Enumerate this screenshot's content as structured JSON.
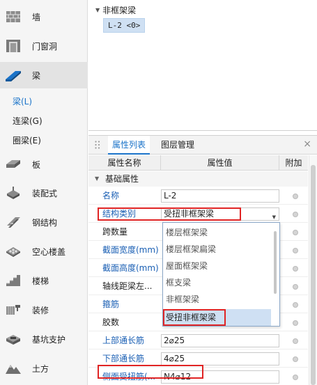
{
  "sidebar": {
    "items": [
      {
        "label": "墙",
        "icon": "wall-icon"
      },
      {
        "label": "门窗洞",
        "icon": "door-window-icon"
      },
      {
        "label": "梁",
        "icon": "beam-icon"
      },
      {
        "label": "板",
        "icon": "slab-icon"
      },
      {
        "label": "装配式",
        "icon": "prefab-icon"
      },
      {
        "label": "钢结构",
        "icon": "steel-structure-icon"
      },
      {
        "label": "空心楼盖",
        "icon": "hollow-floor-icon"
      },
      {
        "label": "楼梯",
        "icon": "stair-icon"
      },
      {
        "label": "装修",
        "icon": "decoration-icon"
      },
      {
        "label": "基坑支护",
        "icon": "foundation-pit-icon"
      },
      {
        "label": "土方",
        "icon": "earthwork-icon"
      }
    ],
    "sub_items": [
      {
        "label": "梁(L)"
      },
      {
        "label": "连梁(G)"
      },
      {
        "label": "圈梁(E)"
      }
    ]
  },
  "tree": {
    "group_label": "非框架梁",
    "leaf_label": "L-2 <0>"
  },
  "panel": {
    "tabs": [
      {
        "label": "属性列表"
      },
      {
        "label": "图层管理"
      }
    ],
    "close_label": "×",
    "columns": [
      "属性名称",
      "属性值",
      "附加"
    ],
    "group_label": "基础属性",
    "rows": [
      {
        "name": "名称",
        "value": "L-2"
      },
      {
        "name": "结构类别",
        "value": "受扭非框架梁"
      },
      {
        "name": "跨数量",
        "value": ""
      },
      {
        "name": "截面宽度(mm)",
        "value": ""
      },
      {
        "name": "截面高度(mm)",
        "value": ""
      },
      {
        "name": "轴线距梁左...",
        "value": ""
      },
      {
        "name": "箍筋",
        "value": ""
      },
      {
        "name": "胶数",
        "value": ""
      },
      {
        "name": "上部通长筋",
        "value": "2⌀25"
      },
      {
        "name": "下部通长筋",
        "value": "4⌀25"
      },
      {
        "name": "侧面受扭筋(...",
        "value": "N4⌀12"
      }
    ],
    "dropdown_options": [
      {
        "label": "楼层框架梁"
      },
      {
        "label": "楼层框架扁梁"
      },
      {
        "label": "屋面框架梁"
      },
      {
        "label": "框支梁"
      },
      {
        "label": "非框架梁"
      },
      {
        "label": "受扭非框架梁"
      }
    ]
  },
  "colors": {
    "accent": "#1a73c9",
    "highlight": "#e02424",
    "selection": "#cfe0f3"
  }
}
